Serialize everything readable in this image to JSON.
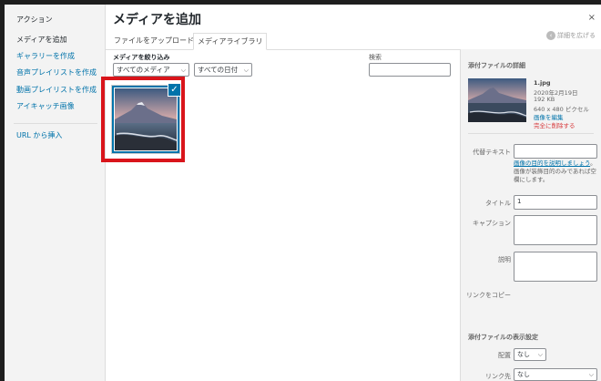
{
  "menu": {
    "heading": "アクション",
    "items": [
      {
        "label": "メディアを追加",
        "active": true
      },
      {
        "label": "ギャラリーを作成",
        "active": false
      },
      {
        "label": "音声プレイリストを作成",
        "active": false
      },
      {
        "label": "動画プレイリストを作成",
        "active": false
      },
      {
        "label": "アイキャッチ画像",
        "active": false
      }
    ],
    "url_insert": "URL から挿入"
  },
  "header": {
    "title": "メディアを追加",
    "close": "×",
    "expand": "詳細を広げる"
  },
  "tabs": [
    {
      "label": "ファイルをアップロード",
      "active": false
    },
    {
      "label": "メディアライブラリ",
      "active": true
    }
  ],
  "filters": {
    "label": "メディアを絞り込み",
    "media_type": "すべてのメディア",
    "date": "すべての日付",
    "search_label": "検索",
    "search_value": ""
  },
  "attachments": [
    {
      "selected": true,
      "icon": "checkmark-icon"
    }
  ],
  "details": {
    "heading": "添付ファイルの詳細",
    "filename": "1.jpg",
    "date": "2020年2月19日",
    "size": "192 KB",
    "dimensions": "640 x 480 ピクセル",
    "edit_link": "画像を編集",
    "delete_link": "完全に削除する",
    "fields": {
      "alt_label": "代替テキスト",
      "alt_value": "",
      "alt_help_link": "画像の目的を説明しましょう",
      "alt_help_text": "。画像が装飾目的のみであれば空欄にします。",
      "title_label": "タイトル",
      "title_value": "1",
      "caption_label": "キャプション",
      "caption_value": "",
      "description_label": "説明",
      "description_value": "",
      "link_label": "リンクをコピー"
    }
  },
  "display": {
    "heading": "添付ファイルの表示設定",
    "align_label": "配置",
    "align_value": "なし",
    "link_label": "リンク先",
    "link_value": "なし"
  },
  "colors": {
    "accent": "#0073aa",
    "highlight": "#d9151b",
    "delete": "#d63638"
  }
}
